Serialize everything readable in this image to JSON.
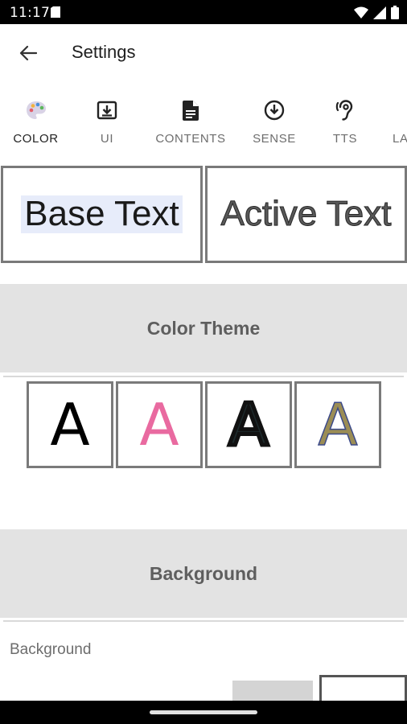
{
  "status_bar": {
    "time": "11:17",
    "icons": [
      "document-icon",
      "wifi-icon",
      "signal-icon",
      "battery-icon"
    ]
  },
  "app_bar": {
    "title": "Settings",
    "back_icon": "arrow-back-icon"
  },
  "tabs": [
    {
      "label": "COLOR",
      "icon": "palette-icon",
      "active": true
    },
    {
      "label": "UI",
      "icon": "download-box-icon",
      "active": false
    },
    {
      "label": "CONTENTS",
      "icon": "document-icon",
      "active": false
    },
    {
      "label": "SENSE",
      "icon": "arrow-down-circle-icon",
      "active": false
    },
    {
      "label": "TTS",
      "icon": "hearing-icon",
      "active": false
    },
    {
      "label": "LA",
      "icon": "",
      "active": false
    }
  ],
  "preview": {
    "base_text": "Base Text",
    "active_text": "Active Text"
  },
  "sections": {
    "color_theme": "Color Theme",
    "background": "Background"
  },
  "color_themes": [
    {
      "glyph": "A",
      "fill": "#000000"
    },
    {
      "glyph": "A",
      "fill": "#e96aa0"
    },
    {
      "glyph": "A",
      "fill": "#1d2a2c",
      "outline": "#111111"
    },
    {
      "glyph": "A",
      "fill": "#9b8d55",
      "outline": "#3c4a8a"
    }
  ],
  "background": {
    "label": "Background",
    "swatches": [
      "#d4d4d4",
      "#ffffff"
    ]
  },
  "colors": {
    "accent_indicator": "#5b9bd5",
    "section_bg": "#e3e3e3",
    "highlight_bg": "#e7ecfa"
  }
}
